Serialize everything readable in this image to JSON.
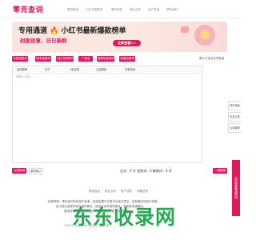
{
  "header": {
    "logo": "零克查词",
    "nav": [
      "零克首页",
      "小红书违禁词",
      "零克网站",
      "商业合作",
      "用户查询",
      "联系我们"
    ]
  },
  "banner": {
    "title": "专用通道 🔥 小红书最新爆款榜单",
    "subtitle": "封面创意、日日新鲜",
    "button": "立即查看>>"
  },
  "tabs": {
    "items": [
      "抖音违禁词",
      "快手违禁词",
      "小红书违禁词",
      "广告法",
      "视频号违禁词",
      "淘宝违禁词"
    ],
    "right_link": "累计已查询文章数量"
  },
  "editor": {
    "toolbar": [
      "高亮替换",
      "清空",
      "一键复制",
      "云端替换",
      "字数检测"
    ],
    "placeholder": "请输入内容"
  },
  "sidebar": [
    "操作指南",
    "历史记录",
    "云端替换"
  ],
  "float_label": "点击查看违禁词",
  "actions": {
    "check": "立即检测",
    "reset": "重新输入",
    "export": "一键替换"
  },
  "stats": {
    "text": "全文：0 字  违禁词：0  敏感词：0 字"
  },
  "footer": {
    "links": [
      "零克首页",
      "商业合作",
      "用户须知",
      "问题反馈"
    ],
    "notes": [
      "免责声明：零克查词仅供用户参考，检测结果不代表平台官方意见，如有疑问请自行判断。",
      "由于部分违禁词存在误判情况，请结合实际语境使用，不构成法律建议。",
      "零克查词提供违禁词检测与替换服务，助力内容安全。"
    ],
    "copyright": "©2023 Lingke.net 零克查词 版权所有"
  },
  "watermark": "东东收录网",
  "colors": {
    "brand": "#e0195a",
    "watermark": "#1fa34a"
  }
}
